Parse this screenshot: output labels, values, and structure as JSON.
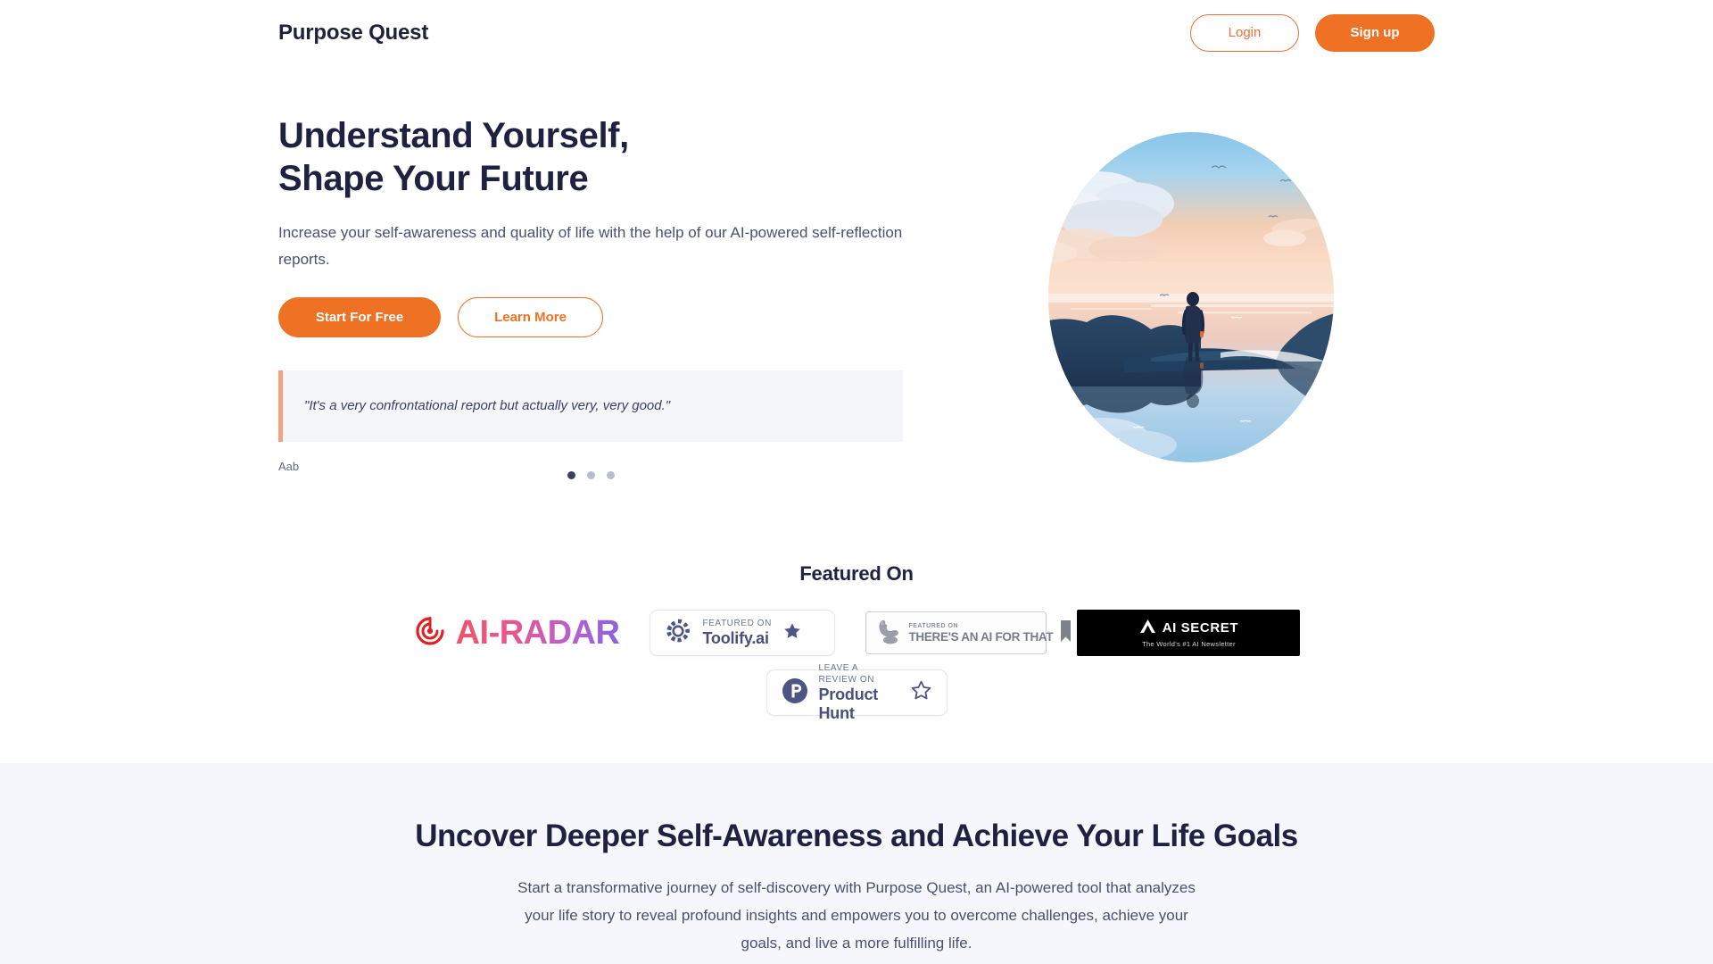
{
  "header": {
    "brand": "Purpose Quest",
    "login_label": "Login",
    "signup_label": "Sign up"
  },
  "hero": {
    "title_line1": "Understand Yourself,",
    "title_line2": "Shape Your Future",
    "subtitle": "Increase your self-awareness and quality of life with the help of our AI-powered self-reflection reports.",
    "cta_primary": "Start For Free",
    "cta_secondary": "Learn More",
    "testimonial": {
      "quote": "\"It's a very confrontational report but actually very, very good.\"",
      "author": "Aab"
    },
    "carousel": {
      "dot_count": 3,
      "active_index": 0
    },
    "illustration_alt": "person-standing-at-sunset-lake-illustration"
  },
  "featured": {
    "title": "Featured On",
    "badges": [
      {
        "id": "ai-radar",
        "name": "AI-RADAR",
        "eyebrow": "",
        "style": "gradient-wordmark"
      },
      {
        "id": "toolify",
        "eyebrow": "FEATURED ON",
        "name": "Toolify.ai",
        "style": "white-card"
      },
      {
        "id": "theres-an-ai-for-that",
        "eyebrow": "FEATURED ON",
        "name": "THERE'S AN AI FOR THAT",
        "style": "gray-card"
      },
      {
        "id": "ai-secret",
        "name": "AI SECRET",
        "eyebrow": "The World's #1 AI Newsletter",
        "style": "black-card"
      },
      {
        "id": "product-hunt",
        "eyebrow": "LEAVE A REVIEW ON",
        "name": "Product Hunt",
        "style": "white-card"
      }
    ]
  },
  "lower": {
    "title": "Uncover Deeper Self-Awareness and Achieve Your Life Goals",
    "body": "Start a transformative journey of self-discovery with Purpose Quest, an AI-powered tool that analyzes your life story to reveal profound insights and empowers you to overcome challenges, achieve your goals, and live a more fulfilling life."
  },
  "colors": {
    "accent_orange": "#ef7123",
    "ink": "#1e2140",
    "body_text": "#4a5070",
    "section_bg": "#f6f7fc",
    "quote_bg": "#f5f6fa",
    "quote_bar": "#f3a183",
    "dot_active": "#3b405f",
    "dot_inactive": "#b9bdcd"
  }
}
